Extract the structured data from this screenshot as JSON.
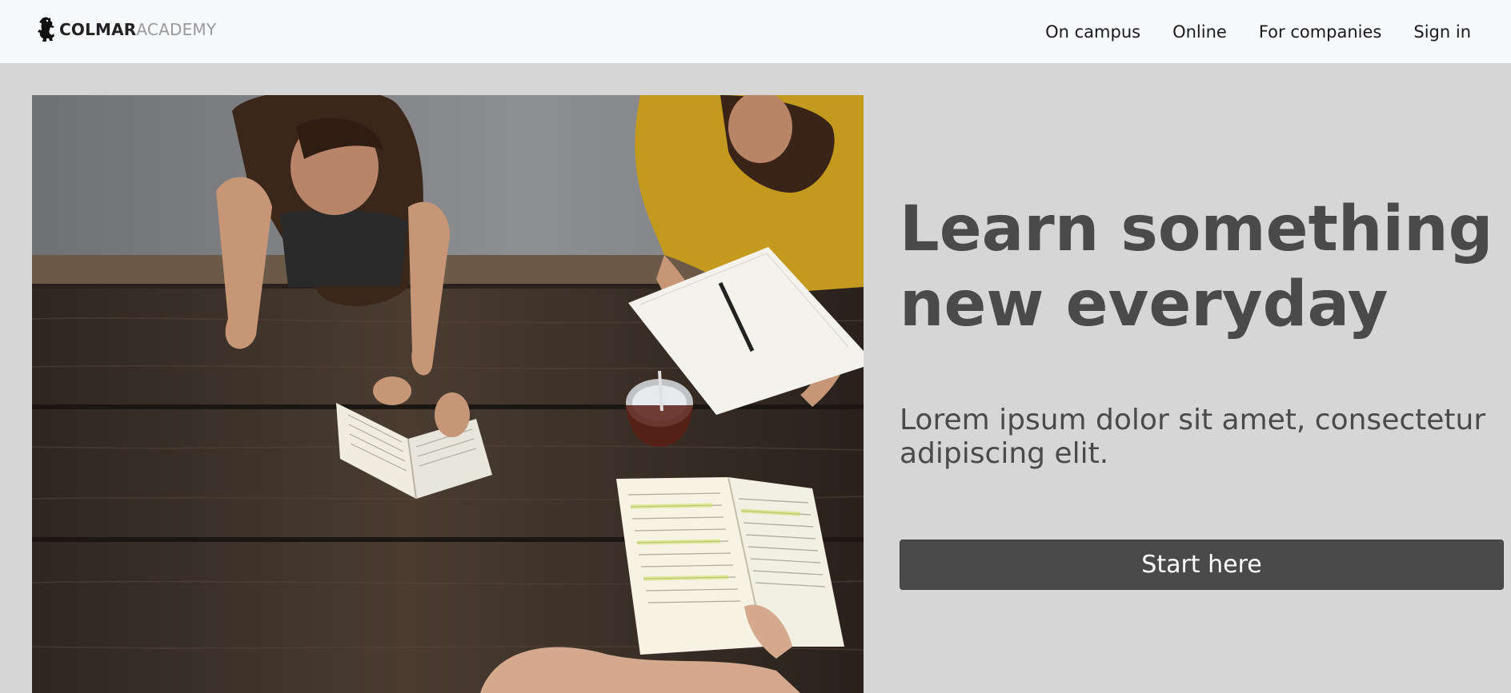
{
  "brand": {
    "name_bold": "COLMAR",
    "name_light": "ACADEMY",
    "logo_icon": "lion-rampant-icon"
  },
  "nav": {
    "items": [
      {
        "label": "On campus"
      },
      {
        "label": "Online"
      },
      {
        "label": "For companies"
      },
      {
        "label": "Sign in"
      }
    ]
  },
  "hero": {
    "image": "students-studying-at-wooden-table-photo",
    "title": "Learn something new everyday",
    "subtitle": "Lorem ipsum dolor sit amet, consectetur adipiscing elit.",
    "cta_label": "Start here"
  },
  "colors": {
    "navbar_bg": "#f8f9fa",
    "page_bg": "#d6d6d6",
    "text_dark": "#4a4a4a",
    "button_bg": "#4a4a4a",
    "button_text": "#ffffff",
    "brand_light": "#9a9a9a"
  }
}
